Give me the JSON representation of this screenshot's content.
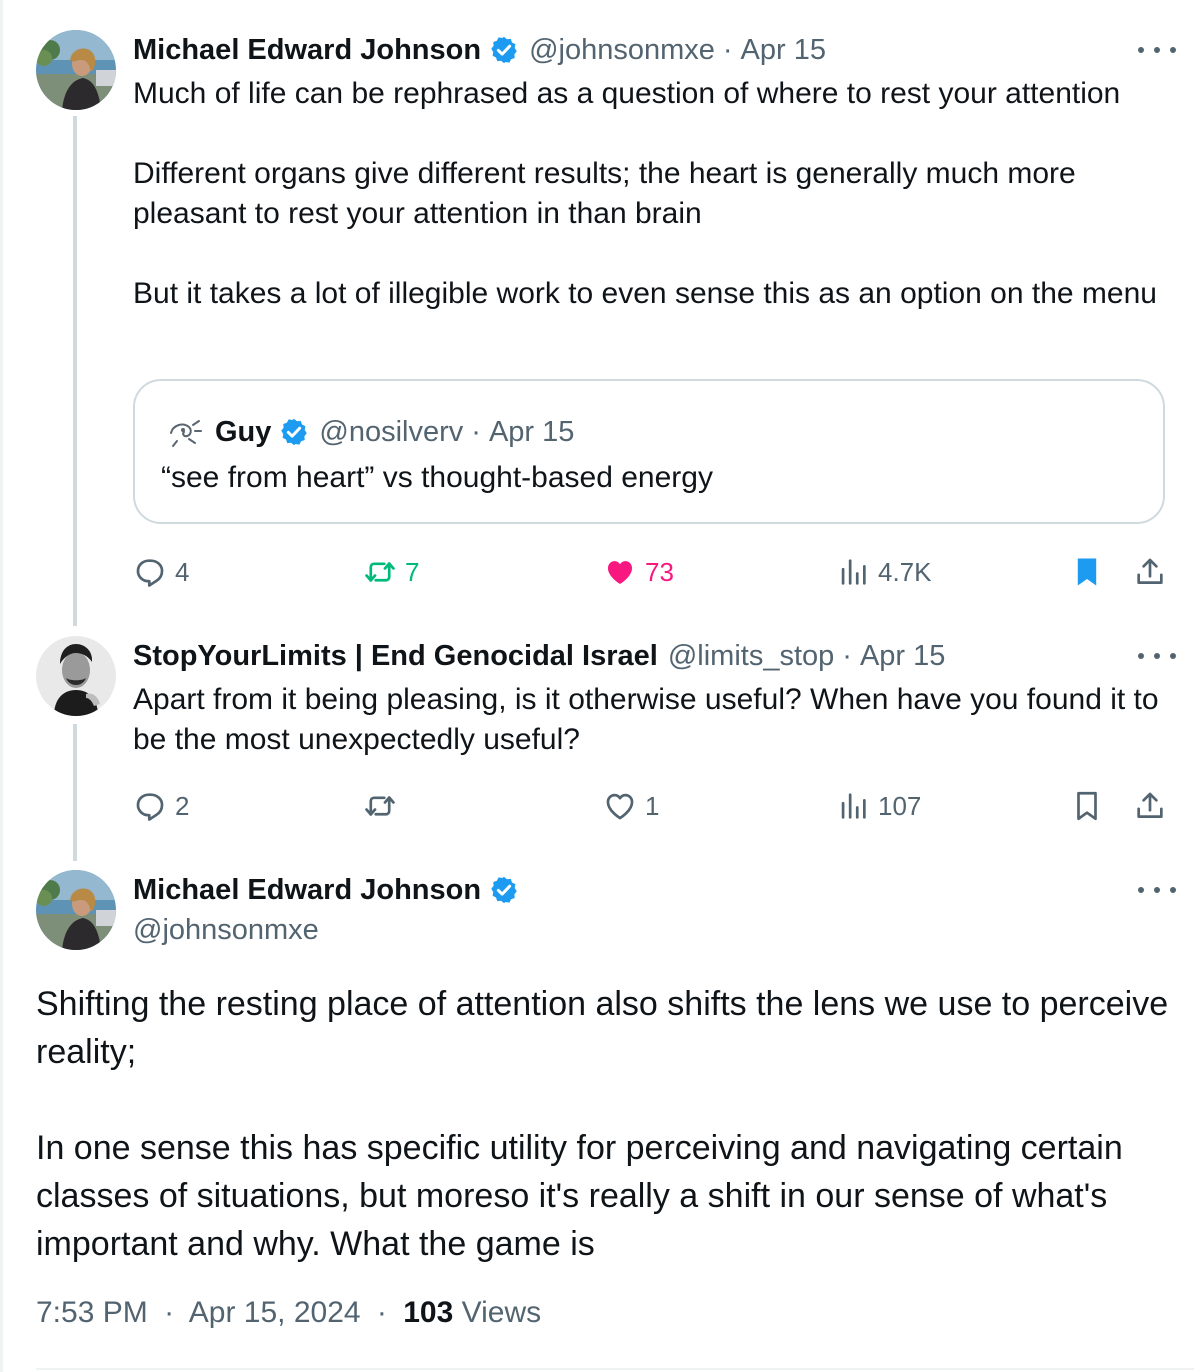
{
  "tweet1": {
    "name": "Michael Edward Johnson",
    "handle": "@johnsonmxe",
    "separator": "·",
    "date": "Apr 15",
    "text": "Much of life can be rephrased as a question of where to rest your attention\n\nDifferent organs give different results; the heart is generally much more pleasant to rest your attention in than brain\n\nBut it takes a lot of illegible work to even sense this as an option on the menu",
    "quote": {
      "name": "Guy",
      "handle": "@nosilverv",
      "separator": "·",
      "date": "Apr 15",
      "text": "“see from heart” vs thought-based energy"
    },
    "actions": {
      "replies": "4",
      "retweets": "7",
      "likes": "73",
      "views": "4.7K",
      "retweeted": true,
      "liked": true,
      "bookmarked": true
    }
  },
  "tweet2": {
    "name": "StopYourLimits | End Genocidal Israel",
    "handle": "@limits_stop",
    "separator": "·",
    "date": "Apr 15",
    "text": "Apart from it being pleasing, is it otherwise useful? When have you found it to be the most unexpectedly useful?",
    "actions": {
      "replies": "2",
      "retweets": "",
      "likes": "1",
      "views": "107",
      "retweeted": false,
      "liked": false,
      "bookmarked": false
    }
  },
  "main_tweet": {
    "name": "Michael Edward Johnson",
    "handle": "@johnsonmxe",
    "text": "Shifting the resting place of attention also shifts the lens we use to perceive reality;\n\nIn one sense this has specific utility for perceiving and navigating certain classes of situations, but moreso it's really a shift in our sense of what's important and why. What the game is",
    "time": "7:53 PM",
    "separator": "·",
    "date": "Apr 15, 2024",
    "views_count": "103",
    "views_label": "Views"
  },
  "colors": {
    "text_primary": "#0f1419",
    "text_secondary": "#536471",
    "verified_blue": "#1d9bf0",
    "retweet_green": "#00ba7c",
    "like_pink": "#f91880",
    "border": "#cfd9de"
  },
  "icons": {
    "verified": "verified-badge-icon",
    "more": "more-options-icon",
    "reply": "reply-icon",
    "retweet": "retweet-icon",
    "like": "heart-icon",
    "views": "views-chart-icon",
    "bookmark": "bookmark-icon",
    "share": "share-icon"
  }
}
